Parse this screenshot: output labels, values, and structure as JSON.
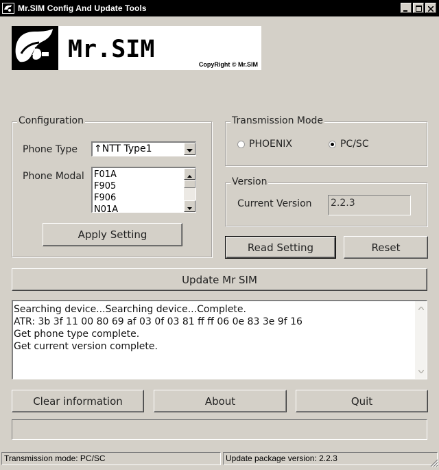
{
  "window": {
    "title": "Mr.SIM Config And Update Tools"
  },
  "logo": {
    "text": "Mr.SIM",
    "copyright": "CopyRight © Mr.SIM"
  },
  "configuration": {
    "legend": "Configuration",
    "phone_type_label": "Phone Type",
    "phone_type_value": "↑NTT Type1",
    "phone_modal_label": "Phone Modal",
    "phone_modal_items": [
      "F01A",
      "F905",
      "F906",
      "N01A"
    ],
    "apply_button": "Apply Setting"
  },
  "transmission": {
    "legend": "Transmission Mode",
    "options": [
      {
        "label": "PHOENIX",
        "selected": false
      },
      {
        "label": "PC/SC",
        "selected": true
      }
    ]
  },
  "version": {
    "legend": "Version",
    "current_label": "Current Version",
    "current_value": "2.2.3"
  },
  "buttons": {
    "read_setting": "Read Setting",
    "reset": "Reset",
    "update": "Update Mr SIM",
    "clear": "Clear information",
    "about": "About",
    "quit": "Quit"
  },
  "log": {
    "lines": [
      "Searching device...Searching device...Complete.",
      "ATR: 3b 3f 11 00 80 69 af 03 0f 03 81 ff ff 06 0e 83 3e 9f 16",
      "Get phone type complete.",
      "Get current version complete."
    ]
  },
  "status": {
    "transmission": "Transmission mode: PC/SC",
    "update_package": "Update package version: 2.2.3"
  },
  "icons": {
    "app": "app-logo-icon",
    "minimize": "minimize-icon",
    "maximize": "maximize-icon",
    "close": "close-icon"
  },
  "colors": {
    "face": "#d4d0c8",
    "titlebar": "#000000"
  }
}
